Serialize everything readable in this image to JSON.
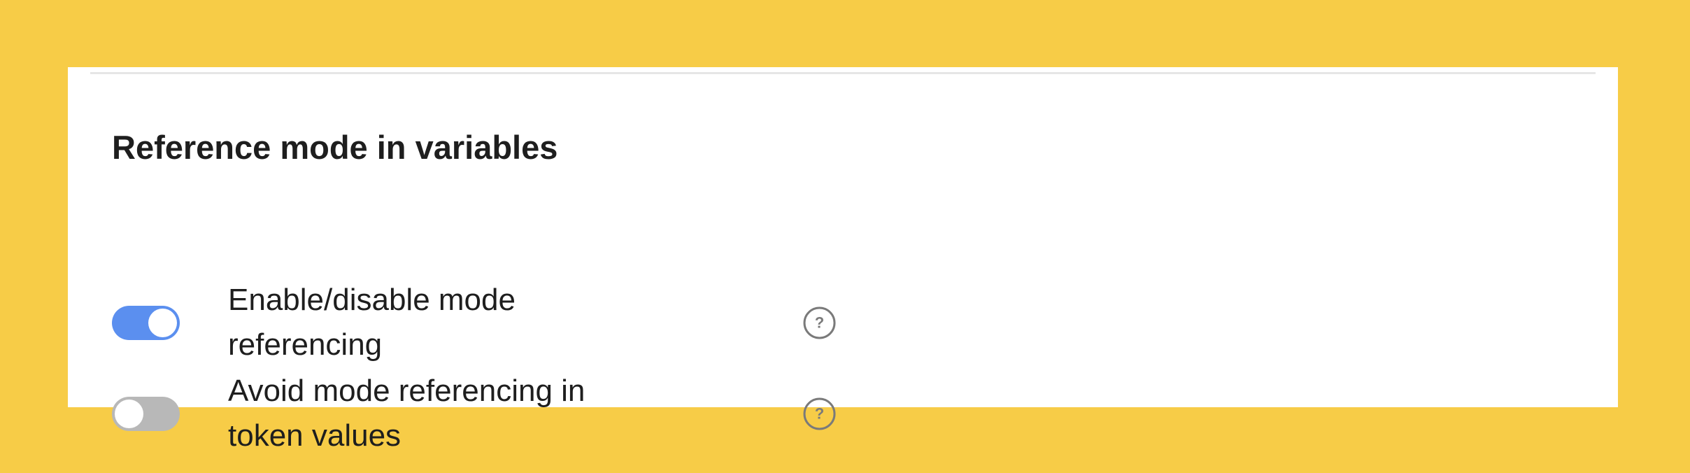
{
  "colors": {
    "page_background": "#F7CC47",
    "panel_background": "#FFFFFF",
    "toggle_on": "#5B8FEF",
    "toggle_off": "#B8B8B8",
    "text": "#1E1E1E",
    "help_icon": "#7A7A7A"
  },
  "section": {
    "title": "Reference mode in variables"
  },
  "settings": [
    {
      "label": "Enable/disable mode referencing",
      "enabled": true,
      "toggle_icon": "toggle-on-icon",
      "help_icon": "question-circle-icon"
    },
    {
      "label": "Avoid mode referencing in token values",
      "enabled": false,
      "toggle_icon": "toggle-off-icon",
      "help_icon": "question-circle-icon"
    }
  ]
}
